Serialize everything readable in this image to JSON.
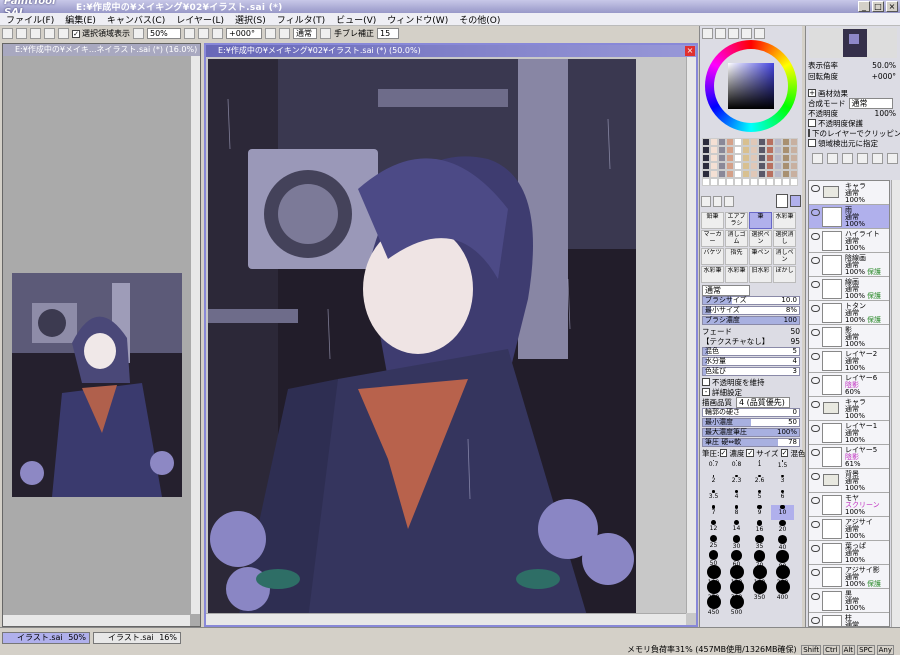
{
  "app": {
    "logo": "PaintTool SAI",
    "title": "E:¥作成中の¥メイキング¥02¥イラスト.sai (*)"
  },
  "menu": [
    "ファイル(F)",
    "編集(E)",
    "キャンバス(C)",
    "レイヤー(L)",
    "選択(S)",
    "フィルタ(T)",
    "ビュー(V)",
    "ウィンドウ(W)",
    "その他(O)"
  ],
  "toolbar": {
    "show_selection": "選択領域表示",
    "zoom": "50%",
    "rotation": "+000°",
    "mode": "通常",
    "stabilizer_label": "手ブレ補正",
    "stabilizer": "15"
  },
  "windows": {
    "nav_title": "E:¥作成中の¥メイキ...ネイラスト.sai (*) (16.0%)",
    "main_title": "E:¥作成中の¥メイキング¥02¥イラスト.sai (*) (50.0%)"
  },
  "status": {
    "tabs": [
      {
        "name": "イラスト.sai",
        "zoom": "50%"
      },
      {
        "name": "イラスト.sai",
        "zoom": "16%"
      }
    ],
    "memory": "メモリ負荷率31% (457MB使用/1326MB確保)",
    "keys": [
      "Shift",
      "Ctrl",
      "Alt",
      "SPC",
      "Any"
    ]
  },
  "colors": {
    "accent": "#8888d8",
    "title": "#9898c8",
    "selected": "#b0b0ec"
  },
  "nav_panel": {
    "zoom_label": "表示倍率",
    "zoom": "50.0%",
    "rot_label": "回転角度",
    "rot": "+000°"
  },
  "layer_props": {
    "effect": "画材効果",
    "blend_label": "合成モード",
    "blend": "通常",
    "opacity_label": "不透明度",
    "opacity": "100%",
    "opts": [
      "不透明度保護",
      "下のレイヤーでクリッピング",
      "領域検出元に指定"
    ]
  },
  "tools": [
    [
      "鉛筆",
      "エアブラシ",
      "筆",
      "水彩筆"
    ],
    [
      "マーカー",
      "消しゴム",
      "選択ペン",
      "選択消し"
    ],
    [
      "バケツ",
      "指先",
      "筆ペン",
      "消しペン"
    ],
    [
      "水彩筆",
      "水彩筆",
      "旧水彩",
      "ぼかし"
    ]
  ],
  "brush": {
    "mode": "通常",
    "size_label": "ブラシサイズ",
    "size_mult": "x1.0",
    "size": "10.0",
    "min_label": "最小サイズ",
    "min": "8%",
    "density_label": "ブラシ濃度",
    "density": "100",
    "edge": "フェード",
    "edge_val": "50",
    "texture": "【テクスチャなし】",
    "texture_val": "95",
    "blend_label": "混色",
    "blend": "5",
    "water_label": "水分量",
    "water": "4",
    "persist_label": "色延び",
    "persist": "3",
    "keep_opacity": "不透明度を維持",
    "detail": "詳細設定",
    "quality_label": "描画品質",
    "quality": "4 (品質優先)",
    "hardness_label": "輪郭の硬さ",
    "hardness": "0",
    "mindens_label": "最小濃度",
    "mindens": "50",
    "maxpress_label": "最大濃度筆圧",
    "maxpress": "100%",
    "press_label": "筆圧 硬⇔軟",
    "press": "78",
    "press_opts": "筆圧:",
    "dens": "濃度",
    "sz": "サイズ",
    "mix": "混色",
    "sizes": [
      "0.7",
      "0.8",
      "1",
      "1.5",
      "2",
      "2.3",
      "2.6",
      "3",
      "3.5",
      "4",
      "5",
      "6",
      "7",
      "8",
      "9",
      "10",
      "12",
      "14",
      "16",
      "20",
      "25",
      "30",
      "35",
      "40",
      "50",
      "60",
      "70",
      "80",
      "100",
      "120",
      "160",
      "200",
      "250",
      "300",
      "350",
      "400",
      "450",
      "500"
    ]
  },
  "layers": [
    {
      "name": "キャラ",
      "mode": "通常",
      "opacity": "100%",
      "folder": true,
      "sel": false
    },
    {
      "name": "雨",
      "mode": "通常",
      "opacity": "100%",
      "folder": false,
      "sel": true
    },
    {
      "name": "ハイライト",
      "mode": "通常",
      "opacity": "100%",
      "folder": false,
      "sel": false
    },
    {
      "name": "陰線画",
      "mode": "通常",
      "opacity": "100%",
      "extra": "保護",
      "folder": false,
      "sel": false
    },
    {
      "name": "線画",
      "mode": "通常",
      "opacity": "100%",
      "extra": "保護",
      "folder": false,
      "sel": false
    },
    {
      "name": "トタン",
      "mode": "通常",
      "opacity": "100%",
      "extra": "保護",
      "folder": false,
      "sel": false
    },
    {
      "name": "影",
      "mode": "通常",
      "opacity": "100%",
      "folder": false,
      "sel": false
    },
    {
      "name": "レイヤー2",
      "mode": "通常",
      "opacity": "100%",
      "folder": false,
      "sel": false
    },
    {
      "name": "レイヤー6",
      "mode": "陰影",
      "opacity": "60%",
      "folder": false,
      "sel": false
    },
    {
      "name": "キャラ",
      "mode": "通常",
      "opacity": "100%",
      "folder": true,
      "sel": false
    },
    {
      "name": "レイヤー1",
      "mode": "通常",
      "opacity": "100%",
      "folder": false,
      "sel": false
    },
    {
      "name": "レイヤー5",
      "mode": "陰影",
      "opacity": "61%",
      "folder": false,
      "sel": false
    },
    {
      "name": "背景",
      "mode": "通常",
      "opacity": "100%",
      "folder": true,
      "sel": false
    },
    {
      "name": "モヤ",
      "mode": "スクリーン",
      "opacity": "100%",
      "folder": false,
      "sel": false
    },
    {
      "name": "アジサイ",
      "mode": "通常",
      "opacity": "100%",
      "folder": false,
      "sel": false
    },
    {
      "name": "葉っぱ",
      "mode": "通常",
      "opacity": "100%",
      "folder": false,
      "sel": false
    },
    {
      "name": "アジサイ影",
      "mode": "通常",
      "opacity": "100%",
      "extra": "保護",
      "folder": false,
      "sel": false
    },
    {
      "name": "黒",
      "mode": "通常",
      "opacity": "100%",
      "folder": false,
      "sel": false
    },
    {
      "name": "柱",
      "mode": "通常",
      "opacity": "",
      "folder": false,
      "sel": false
    }
  ]
}
